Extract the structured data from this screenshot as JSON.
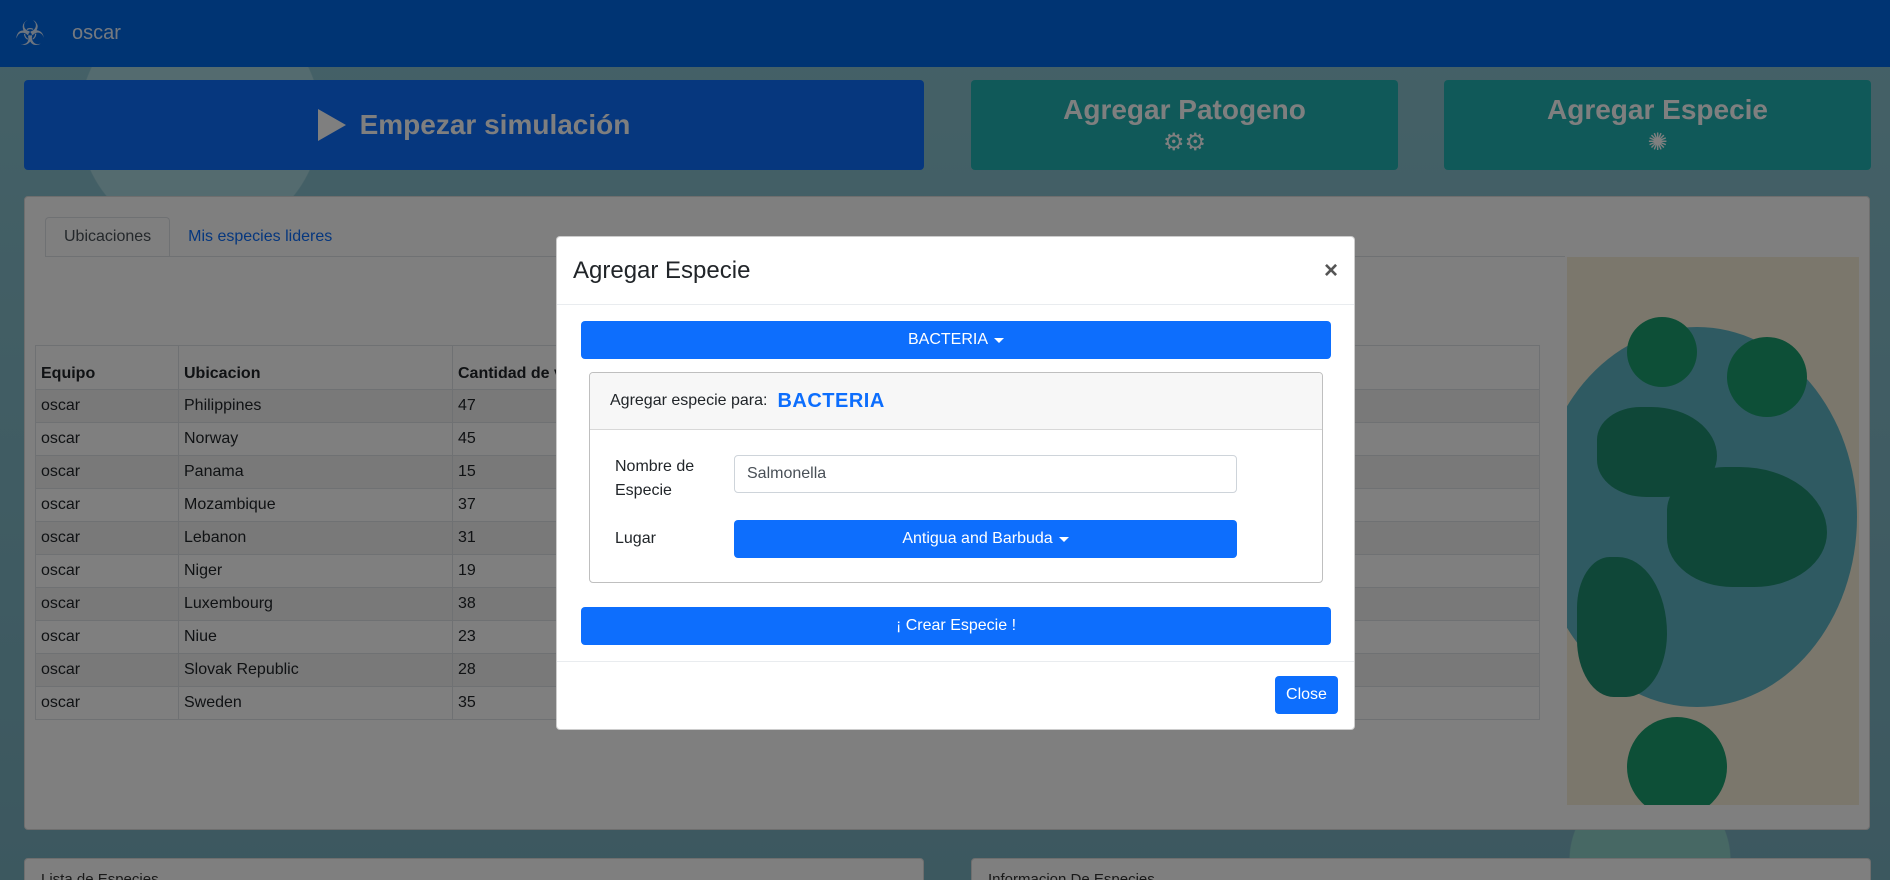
{
  "navbar": {
    "brand_icon": "biohazard-icon",
    "username": "oscar"
  },
  "actions": {
    "start_label": "Empezar simulación",
    "start_icon": "play-icon",
    "patogeno_label": "Agregar Patogeno",
    "patogeno_icon": "gears-icon",
    "especie_label": "Agregar Especie",
    "especie_icon": "virus-icon"
  },
  "tabs": [
    {
      "label": "Ubicaciones",
      "active": true
    },
    {
      "label": "Mis especies lideres",
      "active": false
    }
  ],
  "table": {
    "headers": [
      "Equipo",
      "Ubicacion",
      "Cantidad de v"
    ],
    "rows": [
      [
        "oscar",
        "Philippines",
        "47"
      ],
      [
        "oscar",
        "Norway",
        "45"
      ],
      [
        "oscar",
        "Panama",
        "15"
      ],
      [
        "oscar",
        "Mozambique",
        "37"
      ],
      [
        "oscar",
        "Lebanon",
        "31"
      ],
      [
        "oscar",
        "Niger",
        "19"
      ],
      [
        "oscar",
        "Luxembourg",
        "38"
      ],
      [
        "oscar",
        "Niue",
        "23"
      ],
      [
        "oscar",
        "Slovak Republic",
        "28"
      ],
      [
        "oscar",
        "Sweden",
        "35"
      ]
    ]
  },
  "bottom_cards": {
    "left": "Lista de Especies",
    "right": "Informacion De Especies"
  },
  "modal": {
    "title": "Agregar Especie",
    "close_symbol": "×",
    "pathogen_dropdown": "BACTERIA",
    "inner_header_label": "Agregar especie para:",
    "inner_header_value": "BACTERIA",
    "name_label_line1": "Nombre de",
    "name_label_line2": "Especie",
    "name_value": "Salmonella",
    "lugar_label": "Lugar",
    "lugar_dropdown": "Antigua and Barbuda",
    "create_button": "¡ Crear Especie !",
    "close_button": "Close"
  },
  "colors": {
    "primary": "#0d6efd",
    "navbar": "#0069e6",
    "teal": "#20b3b3"
  }
}
